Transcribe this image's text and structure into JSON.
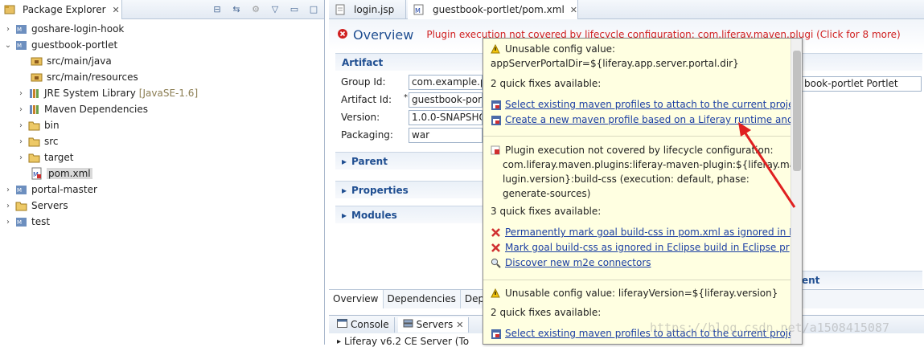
{
  "explorer": {
    "title": "Package Explorer",
    "items": [
      {
        "label": "goshare-login-hook",
        "twisty": "›",
        "icon": "maven-project-icon"
      },
      {
        "label": "guestbook-portlet",
        "twisty": "⌄",
        "icon": "maven-project-icon"
      },
      {
        "label": "src/main/java",
        "twisty": "",
        "icon": "source-folder-icon"
      },
      {
        "label": "src/main/resources",
        "twisty": "",
        "icon": "source-folder-icon"
      },
      {
        "label": "JRE System Library",
        "suffix": "[JavaSE-1.6]",
        "twisty": "›",
        "icon": "library-icon"
      },
      {
        "label": "Maven Dependencies",
        "twisty": "›",
        "icon": "library-icon"
      },
      {
        "label": "bin",
        "twisty": "›",
        "icon": "folder-icon"
      },
      {
        "label": "src",
        "twisty": "›",
        "icon": "folder-icon"
      },
      {
        "label": "target",
        "twisty": "›",
        "icon": "folder-icon"
      },
      {
        "label": "pom.xml",
        "twisty": "",
        "icon": "xml-file-icon"
      },
      {
        "label": "portal-master",
        "twisty": "›",
        "icon": "maven-project-icon"
      },
      {
        "label": "Servers",
        "twisty": "›",
        "icon": "folder-icon"
      },
      {
        "label": "test",
        "twisty": "›",
        "icon": "maven-project-icon"
      }
    ]
  },
  "editor": {
    "tabs": [
      {
        "label": "login.jsp"
      },
      {
        "label": "guestbook-portlet/pom.xml"
      }
    ],
    "header_title": "Overview",
    "header_message": "Plugin execution not covered by lifecycle configuration: com.liferay.maven.plugi (Click for 8 more)",
    "artifact_section": "Artifact",
    "fields": {
      "group_id_label": "Group Id:",
      "group_id_value": "com.example.p",
      "artifact_id_label": "Artifact Id:",
      "artifact_id_value": "guestbook-por",
      "version_label": "Version:",
      "version_value": "1.0.0-SNAPSHO",
      "packaging_label": "Packaging:",
      "packaging_value": "war",
      "name_value": "book-portlet Portlet"
    },
    "sections": {
      "parent": "Parent",
      "properties": "Properties",
      "modules": "Modules",
      "right_fragment": "ent"
    },
    "bottom_tabs": [
      "Overview",
      "Dependencies",
      "Depe"
    ]
  },
  "console": {
    "tabs": [
      "Console",
      "Servers"
    ],
    "row": "Liferay v6.2 CE Server (To"
  },
  "popup": {
    "p1_title": "Unusable config value:",
    "p1_value": "appServerPortalDir=${liferay.app.server.portal.dir}",
    "p1_fixes": "2 quick fixes available:",
    "p1_link1": "Select existing maven profiles to attach to the current proje",
    "p1_link2": "Create a new maven profile based on a Liferay runtime and",
    "p2_line1": "Plugin execution not covered by lifecycle configuration:",
    "p2_line2": "com.liferay.maven.plugins:liferay-maven-plugin:${liferay.maven",
    "p2_line3": "lugin.version}:build-css (execution: default, phase:",
    "p2_line4": "generate-sources)",
    "p2_fixes": "3 quick fixes available:",
    "p2_link1": "Permanently mark goal build-css in pom.xml as ignored in E",
    "p2_link2": "Mark goal build-css as ignored in Eclipse build in Eclipse pr",
    "p2_link3": "Discover new m2e connectors",
    "p3_title": "Unusable config value: liferayVersion=${liferay.version}",
    "p3_fixes": "2 quick fixes available:",
    "p3_link1": "Select existing maven profiles to attach to the current proje"
  },
  "watermark": "https://blog.csdn.net/a1508415087",
  "colors": {
    "link": "#1c3fa3",
    "error": "#d02020",
    "title": "#1f4e91",
    "popup_bg": "#ffffe1",
    "arrow": "#e02020"
  }
}
